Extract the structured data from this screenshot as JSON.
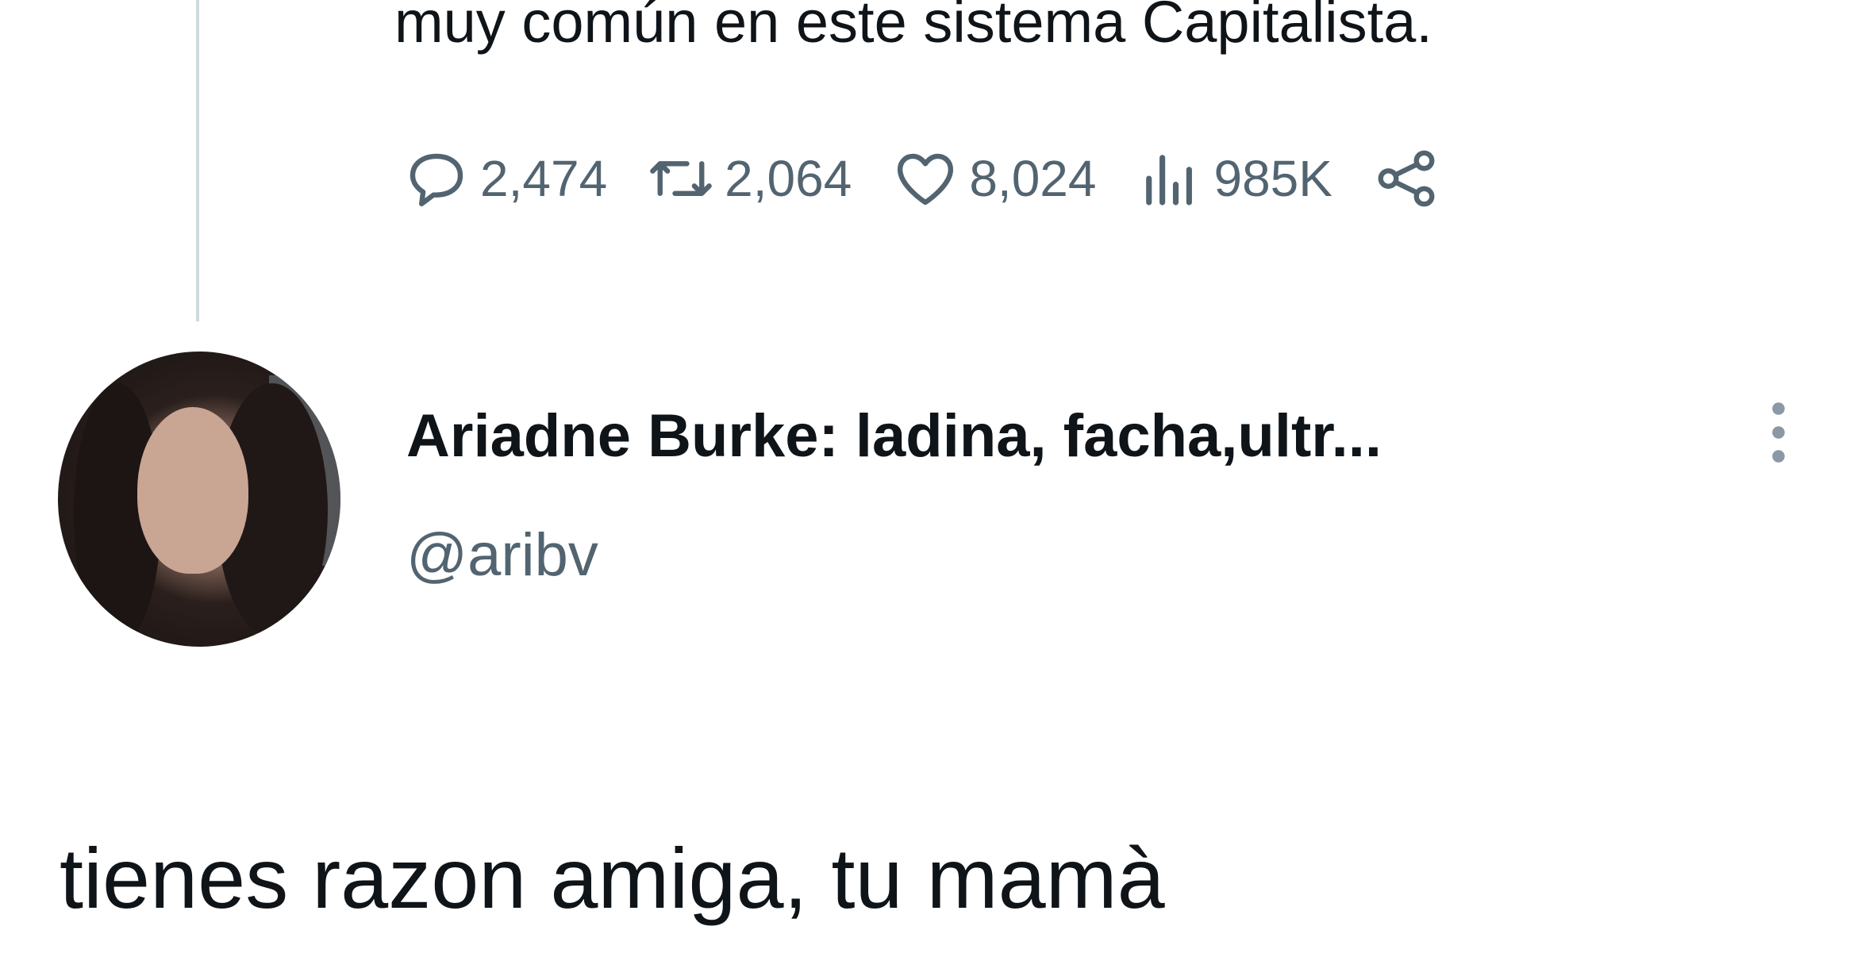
{
  "previous_tweet": {
    "text_tail": "muy común en este sistema Capitalista.",
    "actions": {
      "replies": "2,474",
      "retweets": "2,064",
      "likes": "8,024",
      "views": "985K"
    },
    "icons": [
      "reply-icon",
      "retweet-icon",
      "like-icon",
      "views-icon",
      "share-icon"
    ]
  },
  "reply_tweet": {
    "author_name": "Ariadne Burke: ladina, facha,ultr...",
    "author_handle": "@aribv",
    "text": "tienes razon amiga, tu mamà",
    "more_icon": "more-vertical-icon"
  },
  "colors": {
    "text_primary": "#0f1419",
    "text_secondary": "#536471",
    "thread_line": "#cfd9de",
    "background": "#ffffff"
  }
}
